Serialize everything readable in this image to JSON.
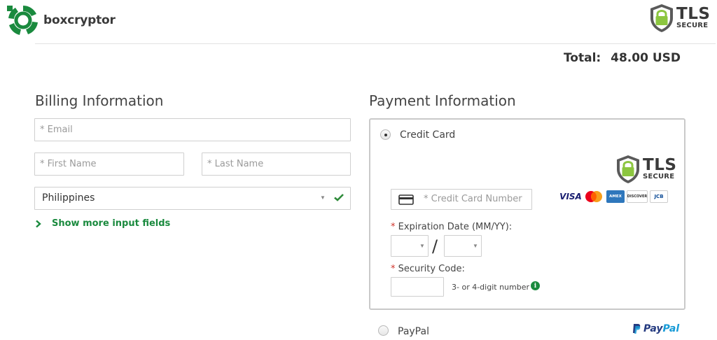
{
  "header": {
    "brand": "boxcryptor",
    "tls_badge": {
      "big": "TLS",
      "small": "SECURE"
    },
    "total_label": "Total:",
    "total_amount": "48.00 USD"
  },
  "billing": {
    "title": "Billing Information",
    "email_placeholder": "* Email",
    "first_name_placeholder": "* First Name",
    "last_name_placeholder": "* Last Name",
    "country_value": "Philippines",
    "show_more_label": "Show more input fields"
  },
  "payment": {
    "title": "Payment Information",
    "credit_card_label": "Credit Card",
    "credit_card_selected": true,
    "card_number_placeholder": "* Credit Card Number",
    "expiration_label": "Expiration Date (MM/YY):",
    "security_label": "Security Code:",
    "required_mark": "*",
    "separator": "/",
    "security_hint": "3- or 4-digit number",
    "card_brands": [
      "VISA",
      "Mastercard",
      "AMEX",
      "DISCOVER",
      "JCB"
    ],
    "tls_badge": {
      "big": "TLS",
      "small": "SECURE"
    },
    "paypal_label": "PayPal",
    "paypal_logo": {
      "part1": "Pay",
      "part2": "Pal"
    }
  },
  "colors": {
    "brand_green": "#1a8a3e",
    "required_red": "#d0342c",
    "paypal_dark": "#253b80",
    "paypal_light": "#179bd7"
  }
}
